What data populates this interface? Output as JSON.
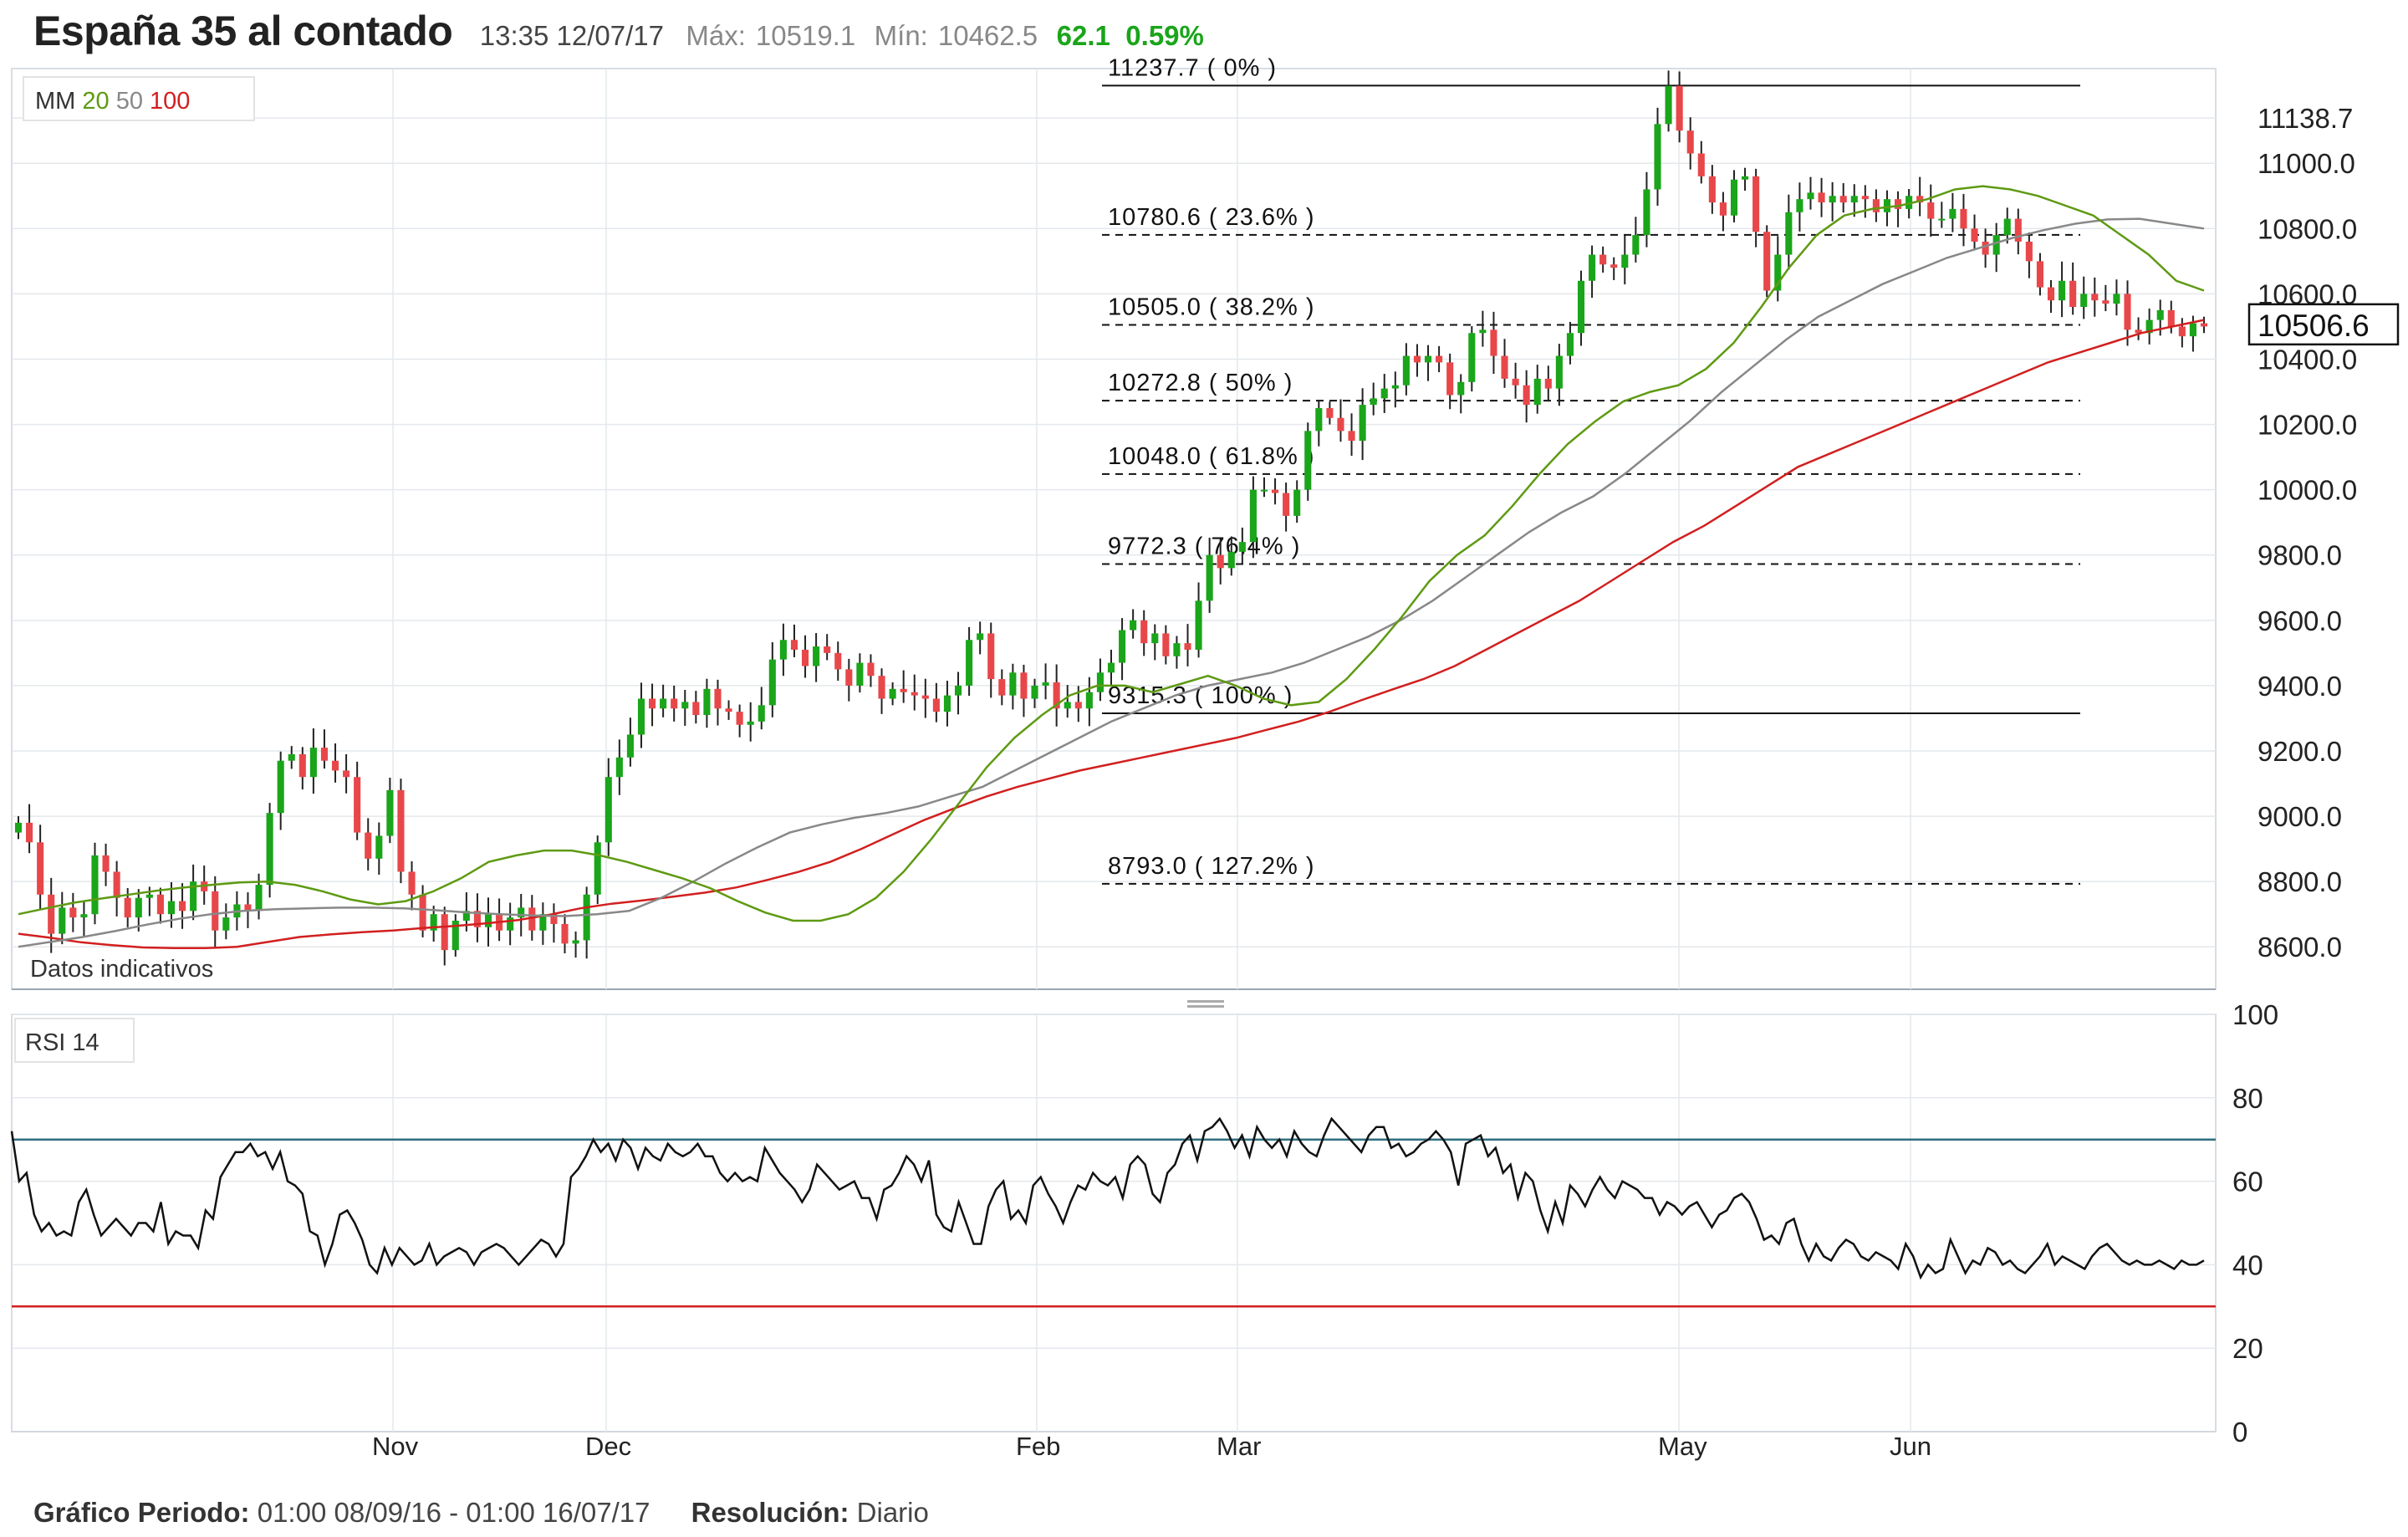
{
  "header": {
    "title": "España 35 al contado",
    "time": "13:35 12/07/17",
    "max_label": "Máx:",
    "max_value": "10519.1",
    "min_label": "Mín:",
    "min_value": "10462.5",
    "change": "62.1",
    "change_pct": "0.59%"
  },
  "colors": {
    "up": "#1aa51a",
    "down": "#e8474a",
    "ma20": "#5e9a12",
    "ma50": "#888888",
    "ma100": "#d21f1f",
    "rsi_upper": "#2f6f80",
    "rsi_lower": "#d21f1f"
  },
  "legend": {
    "ma_label": "MM",
    "ma20": "20",
    "ma50": "50",
    "ma100": "100",
    "rsi_label": "RSI",
    "rsi_period": "14"
  },
  "note": "Datos indicativos",
  "current_price": "10506.6",
  "footer": {
    "period_label": "Gráfico Periodo:",
    "period_value": "01:00 08/09/16 - 01:00 16/07/17",
    "resolution_label": "Resolución:",
    "resolution_value": "Diario"
  },
  "chart_data": [
    {
      "type": "candlestick",
      "y_ticks": [
        "11138.7",
        "11000.0",
        "10800.0",
        "10600.0",
        "10400.0",
        "10200.0",
        "10000.0",
        "9800.0",
        "9600.0",
        "9400.0",
        "9200.0",
        "9000.0",
        "8800.0",
        "8600.0"
      ],
      "ylim": [
        8470,
        11290
      ],
      "x_ticks": [
        "Nov",
        "Dec",
        "Feb",
        "Mar",
        "May",
        "Jun"
      ],
      "fibonacci": [
        {
          "label": "11237.7 ( 0% )",
          "value": 11237.7,
          "style": "solid"
        },
        {
          "label": "10780.6 ( 23.6% )",
          "value": 10780.6,
          "style": "dashed"
        },
        {
          "label": "10505.0 ( 38.2% )",
          "value": 10505.0,
          "style": "dashed"
        },
        {
          "label": "10272.8 ( 50% )",
          "value": 10272.8,
          "style": "dashed"
        },
        {
          "label": "10048.0 ( 61.8% )",
          "value": 10048.0,
          "style": "dashed"
        },
        {
          "label": "9772.3 ( 76.4% )",
          "value": 9772.3,
          "style": "dashed"
        },
        {
          "label": "9315.3 ( 100% )",
          "value": 9315.3,
          "style": "solid"
        },
        {
          "label": "8793.0 ( 127.2% )",
          "value": 8793.0,
          "style": "dashed"
        }
      ],
      "closes": [
        8980,
        8920,
        8760,
        8640,
        8720,
        8690,
        8700,
        8880,
        8830,
        8750,
        8690,
        8750,
        8760,
        8700,
        8740,
        8710,
        8800,
        8770,
        8650,
        8690,
        8730,
        8710,
        8790,
        9010,
        9170,
        9190,
        9120,
        9210,
        9170,
        9140,
        9120,
        8950,
        8870,
        8940,
        9080,
        8830,
        8760,
        8650,
        8700,
        8590,
        8680,
        8710,
        8660,
        8700,
        8650,
        8690,
        8720,
        8650,
        8700,
        8670,
        8610,
        8620,
        8760,
        8920,
        9120,
        9180,
        9250,
        9360,
        9330,
        9360,
        9330,
        9350,
        9310,
        9390,
        9330,
        9320,
        9280,
        9290,
        9340,
        9480,
        9540,
        9510,
        9460,
        9520,
        9500,
        9450,
        9400,
        9470,
        9430,
        9360,
        9390,
        9380,
        9370,
        9360,
        9320,
        9370,
        9400,
        9540,
        9560,
        9420,
        9370,
        9440,
        9360,
        9400,
        9410,
        9330,
        9350,
        9330,
        9380,
        9440,
        9470,
        9570,
        9600,
        9530,
        9560,
        9490,
        9530,
        9510,
        9660,
        9800,
        9760,
        9810,
        9840,
        10000,
        10000,
        9990,
        9920,
        10000,
        10180,
        10250,
        10220,
        10180,
        10150,
        10260,
        10280,
        10310,
        10320,
        10410,
        10390,
        10410,
        10390,
        10290,
        10330,
        10480,
        10490,
        10410,
        10340,
        10320,
        10260,
        10340,
        10310,
        10410,
        10480,
        10640,
        10720,
        10690,
        10680,
        10720,
        10780,
        10920,
        11120,
        11237,
        11100,
        11030,
        10960,
        10880,
        10840,
        10950,
        10960,
        10790,
        10610,
        10720,
        10850,
        10890,
        10910,
        10880,
        10900,
        10880,
        10900,
        10890,
        10850,
        10890,
        10860,
        10900,
        10880,
        10830,
        10830,
        10860,
        10800,
        10760,
        10720,
        10780,
        10830,
        10760,
        10700,
        10620,
        10580,
        10640,
        10560,
        10600,
        10580,
        10570,
        10600,
        10490,
        10480,
        10520,
        10550,
        10500,
        10470,
        10510,
        10500
      ],
      "ma20": [
        8700,
        8718,
        8735,
        8748,
        8760,
        8772,
        8782,
        8790,
        8797,
        8800,
        8790,
        8770,
        8745,
        8730,
        8740,
        8770,
        8810,
        8860,
        8880,
        8895,
        8895,
        8880,
        8860,
        8835,
        8810,
        8780,
        8740,
        8705,
        8680,
        8680,
        8700,
        8750,
        8830,
        8930,
        9040,
        9150,
        9240,
        9310,
        9370,
        9400,
        9400,
        9380,
        9405,
        9430,
        9400,
        9360,
        9340,
        9350,
        9420,
        9510,
        9610,
        9720,
        9800,
        9860,
        9950,
        10050,
        10140,
        10210,
        10270,
        10300,
        10320,
        10370,
        10450,
        10560,
        10680,
        10780,
        10840,
        10860,
        10870,
        10890,
        10920,
        10930,
        10920,
        10900,
        10870,
        10840,
        10780,
        10720,
        10640,
        10610
      ],
      "ma50": [
        8600,
        8615,
        8630,
        8648,
        8668,
        8686,
        8700,
        8710,
        8715,
        8718,
        8720,
        8720,
        8718,
        8712,
        8705,
        8700,
        8696,
        8694,
        8700,
        8710,
        8750,
        8800,
        8855,
        8905,
        8950,
        8975,
        8995,
        9010,
        9030,
        9060,
        9090,
        9140,
        9190,
        9240,
        9290,
        9330,
        9370,
        9400,
        9420,
        9440,
        9470,
        9510,
        9550,
        9600,
        9660,
        9730,
        9800,
        9870,
        9930,
        9980,
        10050,
        10130,
        10210,
        10300,
        10380,
        10460,
        10530,
        10580,
        10630,
        10670,
        10710,
        10740,
        10770,
        10795,
        10815,
        10828,
        10830,
        10815,
        10800
      ],
      "ma100": [
        8640,
        8628,
        8614,
        8605,
        8598,
        8596,
        8596,
        8600,
        8615,
        8630,
        8638,
        8645,
        8650,
        8658,
        8664,
        8672,
        8682,
        8698,
        8718,
        8732,
        8742,
        8754,
        8766,
        8782,
        8805,
        8830,
        8860,
        8900,
        8944,
        8988,
        9025,
        9060,
        9090,
        9115,
        9140,
        9160,
        9180,
        9200,
        9220,
        9240,
        9265,
        9290,
        9320,
        9355,
        9388,
        9420,
        9460,
        9510,
        9560,
        9610,
        9660,
        9720,
        9780,
        9840,
        9890,
        9950,
        10010,
        10070,
        10110,
        10150,
        10190,
        10230,
        10270,
        10310,
        10350,
        10390,
        10420,
        10450,
        10480,
        10500,
        10520
      ]
    },
    {
      "type": "line",
      "name": "RSI 14",
      "y_ticks": [
        "100",
        "80",
        "60",
        "40",
        "20",
        "0"
      ],
      "ylim": [
        0,
        100
      ],
      "levels": [
        70,
        30
      ],
      "values": [
        72,
        60,
        62,
        52,
        48,
        50,
        47,
        48,
        47,
        55,
        58,
        52,
        47,
        49,
        51,
        49,
        47,
        50,
        50,
        48,
        55,
        45,
        48,
        47,
        47,
        44,
        53,
        51,
        61,
        64,
        67,
        67,
        69,
        66,
        67,
        63,
        67,
        60,
        59,
        57,
        48,
        47,
        40,
        45,
        52,
        53,
        50,
        46,
        40,
        38,
        44,
        40,
        44,
        42,
        40,
        41,
        45,
        40,
        42,
        43,
        44,
        43,
        40,
        43,
        44,
        45,
        44,
        42,
        40,
        42,
        44,
        46,
        45,
        42,
        45,
        61,
        63,
        66,
        70,
        67,
        69,
        65,
        70,
        68,
        63,
        68,
        66,
        65,
        69,
        67,
        66,
        67,
        69,
        66,
        66,
        62,
        60,
        62,
        60,
        61,
        60,
        68,
        65,
        62,
        60,
        58,
        55,
        58,
        64,
        62,
        60,
        58,
        59,
        60,
        56,
        56,
        51,
        58,
        59,
        62,
        66,
        64,
        60,
        65,
        52,
        49,
        48,
        55,
        50,
        45,
        45,
        54,
        58,
        60,
        51,
        53,
        50,
        59,
        61,
        57,
        54,
        50,
        55,
        59,
        58,
        62,
        60,
        59,
        61,
        56,
        64,
        66,
        64,
        57,
        55,
        62,
        64,
        69,
        71,
        65,
        72,
        73,
        75,
        72,
        68,
        71,
        66,
        73,
        70,
        68,
        70,
        66,
        72,
        69,
        67,
        66,
        71,
        75,
        73,
        71,
        69,
        67,
        71,
        73,
        73,
        68,
        69,
        66,
        67,
        69,
        70,
        72,
        70,
        67,
        59,
        69,
        70,
        71,
        66,
        68,
        62,
        64,
        56,
        62,
        60,
        53,
        48,
        55,
        50,
        59,
        57,
        54,
        58,
        61,
        58,
        56,
        60,
        59,
        58,
        56,
        56,
        52,
        55,
        54,
        52,
        54,
        55,
        52,
        49,
        52,
        53,
        56,
        57,
        55,
        51,
        46,
        47,
        45,
        50,
        51,
        45,
        41,
        45,
        42,
        41,
        44,
        46,
        45,
        42,
        41,
        43,
        42,
        41,
        39,
        45,
        42,
        37,
        40,
        38,
        39,
        46,
        42,
        38,
        41,
        40,
        44,
        43,
        40,
        41,
        39,
        38,
        40,
        42,
        45,
        40,
        42,
        41,
        40,
        39,
        42,
        44,
        45,
        43,
        41,
        40,
        41,
        40,
        40,
        41,
        40,
        39,
        41,
        40,
        40,
        41
      ]
    }
  ]
}
